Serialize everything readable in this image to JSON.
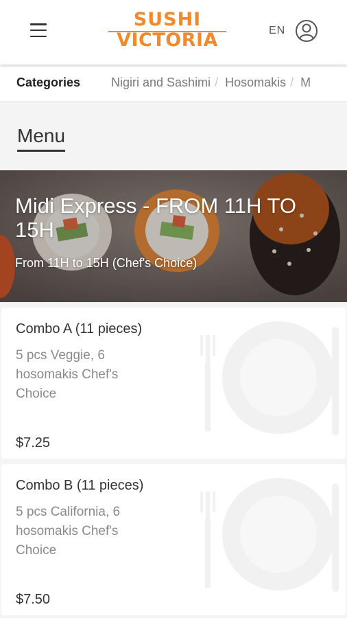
{
  "header": {
    "logo_line1": "SUSHI",
    "logo_line2": "VICTORIA",
    "language": "EN",
    "brand_color": "#f08a2a"
  },
  "categories": {
    "title": "Categories",
    "items": [
      "Nigiri and Sashimi",
      "Hosomakis",
      "M"
    ]
  },
  "menu": {
    "heading": "Menu"
  },
  "section": {
    "title": "Midi Express - FROM 11H TO 15H",
    "subtitle": "From 11H to 15H (Chef's Choice)"
  },
  "items": [
    {
      "name": "Combo A (11 pieces)",
      "description": "5 pcs Veggie, 6 hosomakis Chef's Choice",
      "price": "$7.25"
    },
    {
      "name": "Combo B (11 pieces)",
      "description": "5 pcs California, 6 hosomakis Chef's Choice",
      "price": "$7.50"
    }
  ],
  "icons": {
    "menu": "hamburger-icon",
    "user": "user-account-icon",
    "placeholder": "plate-cutlery-icon"
  }
}
